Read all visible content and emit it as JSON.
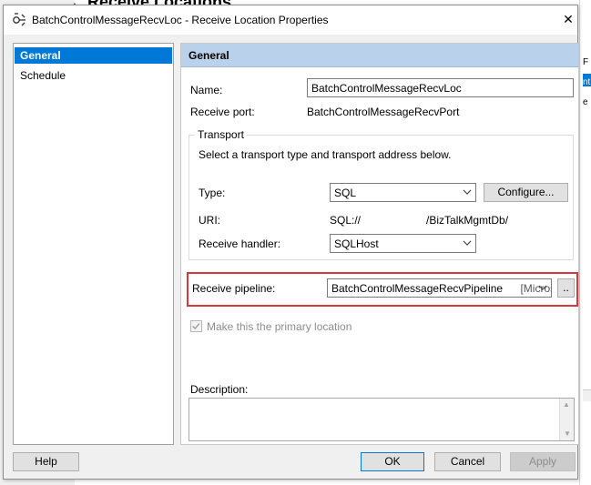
{
  "background": {
    "title": "Receive Locations",
    "right_fragments": [
      "F",
      "nt",
      "e"
    ]
  },
  "dialog": {
    "title": "BatchControlMessageRecvLoc - Receive Location Properties",
    "close_glyph": "✕"
  },
  "nav": {
    "items": [
      {
        "label": "General",
        "selected": true
      },
      {
        "label": "Schedule",
        "selected": false
      }
    ]
  },
  "general": {
    "header": "General",
    "name_label": "Name:",
    "name_value": "BatchControlMessageRecvLoc",
    "receive_port_label": "Receive port:",
    "receive_port_value": "BatchControlMessageRecvPort",
    "transport": {
      "caption": "Transport",
      "instruction": "Select a transport type and transport address below.",
      "type_label": "Type:",
      "type_value": "SQL",
      "configure_button": "Configure...",
      "uri_label": "URI:",
      "uri_prefix": "SQL://",
      "uri_suffix": "/BizTalkMgmtDb/",
      "handler_label": "Receive handler:",
      "handler_value": "SQLHost"
    },
    "pipeline_label": "Receive pipeline:",
    "pipeline_value": "BatchControlMessageRecvPipeline",
    "pipeline_assembly": "[Micros",
    "pipeline_browse": "..",
    "primary_location_label": "Make this the primary location",
    "primary_location_checked": true,
    "description_label": "Description:",
    "description_value": ""
  },
  "footer": {
    "help": "Help",
    "ok": "OK",
    "cancel": "Cancel",
    "apply": "Apply"
  },
  "colors": {
    "selection": "#0078d7",
    "header": "#b9d1ea",
    "highlight": "#d9363e"
  }
}
